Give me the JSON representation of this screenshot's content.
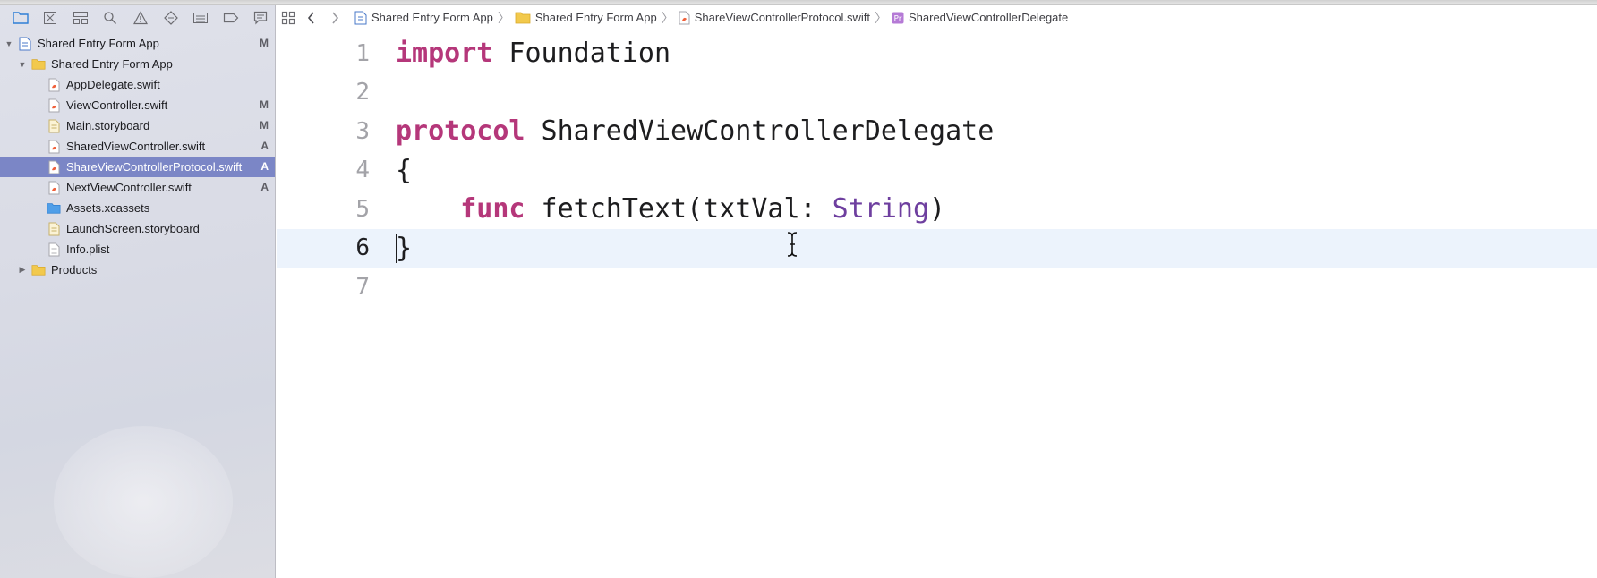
{
  "navigator": {
    "toolbar_icons": [
      "folder-icon",
      "source-control-icon",
      "symbol-navigator-icon",
      "find-icon",
      "issue-warning-icon",
      "test-diamond-icon",
      "debug-list-icon",
      "breakpoint-icon",
      "report-icon"
    ],
    "tree": [
      {
        "label": "Shared Entry Form App",
        "badge": "M",
        "icon": "project-file-icon",
        "disclosure": "open"
      },
      {
        "label": "Shared Entry Form App",
        "badge": "",
        "icon": "folder-icon",
        "disclosure": "open"
      },
      {
        "label": "AppDelegate.swift",
        "badge": "",
        "icon": "swift-file-icon",
        "disclosure": ""
      },
      {
        "label": "ViewController.swift",
        "badge": "M",
        "icon": "swift-file-icon",
        "disclosure": ""
      },
      {
        "label": "Main.storyboard",
        "badge": "M",
        "icon": "storyboard-file-icon",
        "disclosure": ""
      },
      {
        "label": "SharedViewController.swift",
        "badge": "A",
        "icon": "swift-file-icon",
        "disclosure": ""
      },
      {
        "label": "ShareViewControllerProtocol.swift",
        "badge": "A",
        "icon": "swift-file-icon",
        "disclosure": "",
        "selected": true
      },
      {
        "label": "NextViewController.swift",
        "badge": "A",
        "icon": "swift-file-icon",
        "disclosure": ""
      },
      {
        "label": "Assets.xcassets",
        "badge": "",
        "icon": "assets-folder-icon",
        "disclosure": ""
      },
      {
        "label": "LaunchScreen.storyboard",
        "badge": "",
        "icon": "storyboard-file-icon",
        "disclosure": ""
      },
      {
        "label": "Info.plist",
        "badge": "",
        "icon": "plist-file-icon",
        "disclosure": ""
      },
      {
        "label": "Products",
        "badge": "",
        "icon": "folder-icon",
        "disclosure": "closed"
      }
    ]
  },
  "jumpbar": {
    "crumbs": [
      {
        "label": "Shared Entry Form App",
        "icon": "project-file-icon"
      },
      {
        "label": "Shared Entry Form App",
        "icon": "folder-icon"
      },
      {
        "label": "ShareViewControllerProtocol.swift",
        "icon": "swift-file-icon"
      },
      {
        "label": "SharedViewControllerDelegate",
        "icon": "protocol-icon"
      }
    ]
  },
  "editor": {
    "current_line": 6,
    "lines": [
      {
        "num": "1",
        "tokens": [
          {
            "t": "import",
            "c": "kw"
          },
          {
            "t": " Foundation",
            "c": ""
          }
        ]
      },
      {
        "num": "2",
        "tokens": []
      },
      {
        "num": "3",
        "tokens": [
          {
            "t": "protocol",
            "c": "kw"
          },
          {
            "t": " SharedViewControllerDelegate",
            "c": ""
          }
        ]
      },
      {
        "num": "4",
        "tokens": [
          {
            "t": "{",
            "c": ""
          }
        ]
      },
      {
        "num": "5",
        "tokens": [
          {
            "t": "    ",
            "c": ""
          },
          {
            "t": "func",
            "c": "kw"
          },
          {
            "t": " fetchText(txtVal: ",
            "c": ""
          },
          {
            "t": "String",
            "c": "ty"
          },
          {
            "t": ")",
            "c": ""
          }
        ]
      },
      {
        "num": "6",
        "tokens": [
          {
            "t": "}",
            "c": ""
          }
        ]
      },
      {
        "num": "7",
        "tokens": []
      }
    ]
  },
  "colors": {
    "keyword": "#b5377a",
    "type": "#6e3f9f",
    "selection": "#7b86c6",
    "current_line": "#ecf3fc"
  }
}
